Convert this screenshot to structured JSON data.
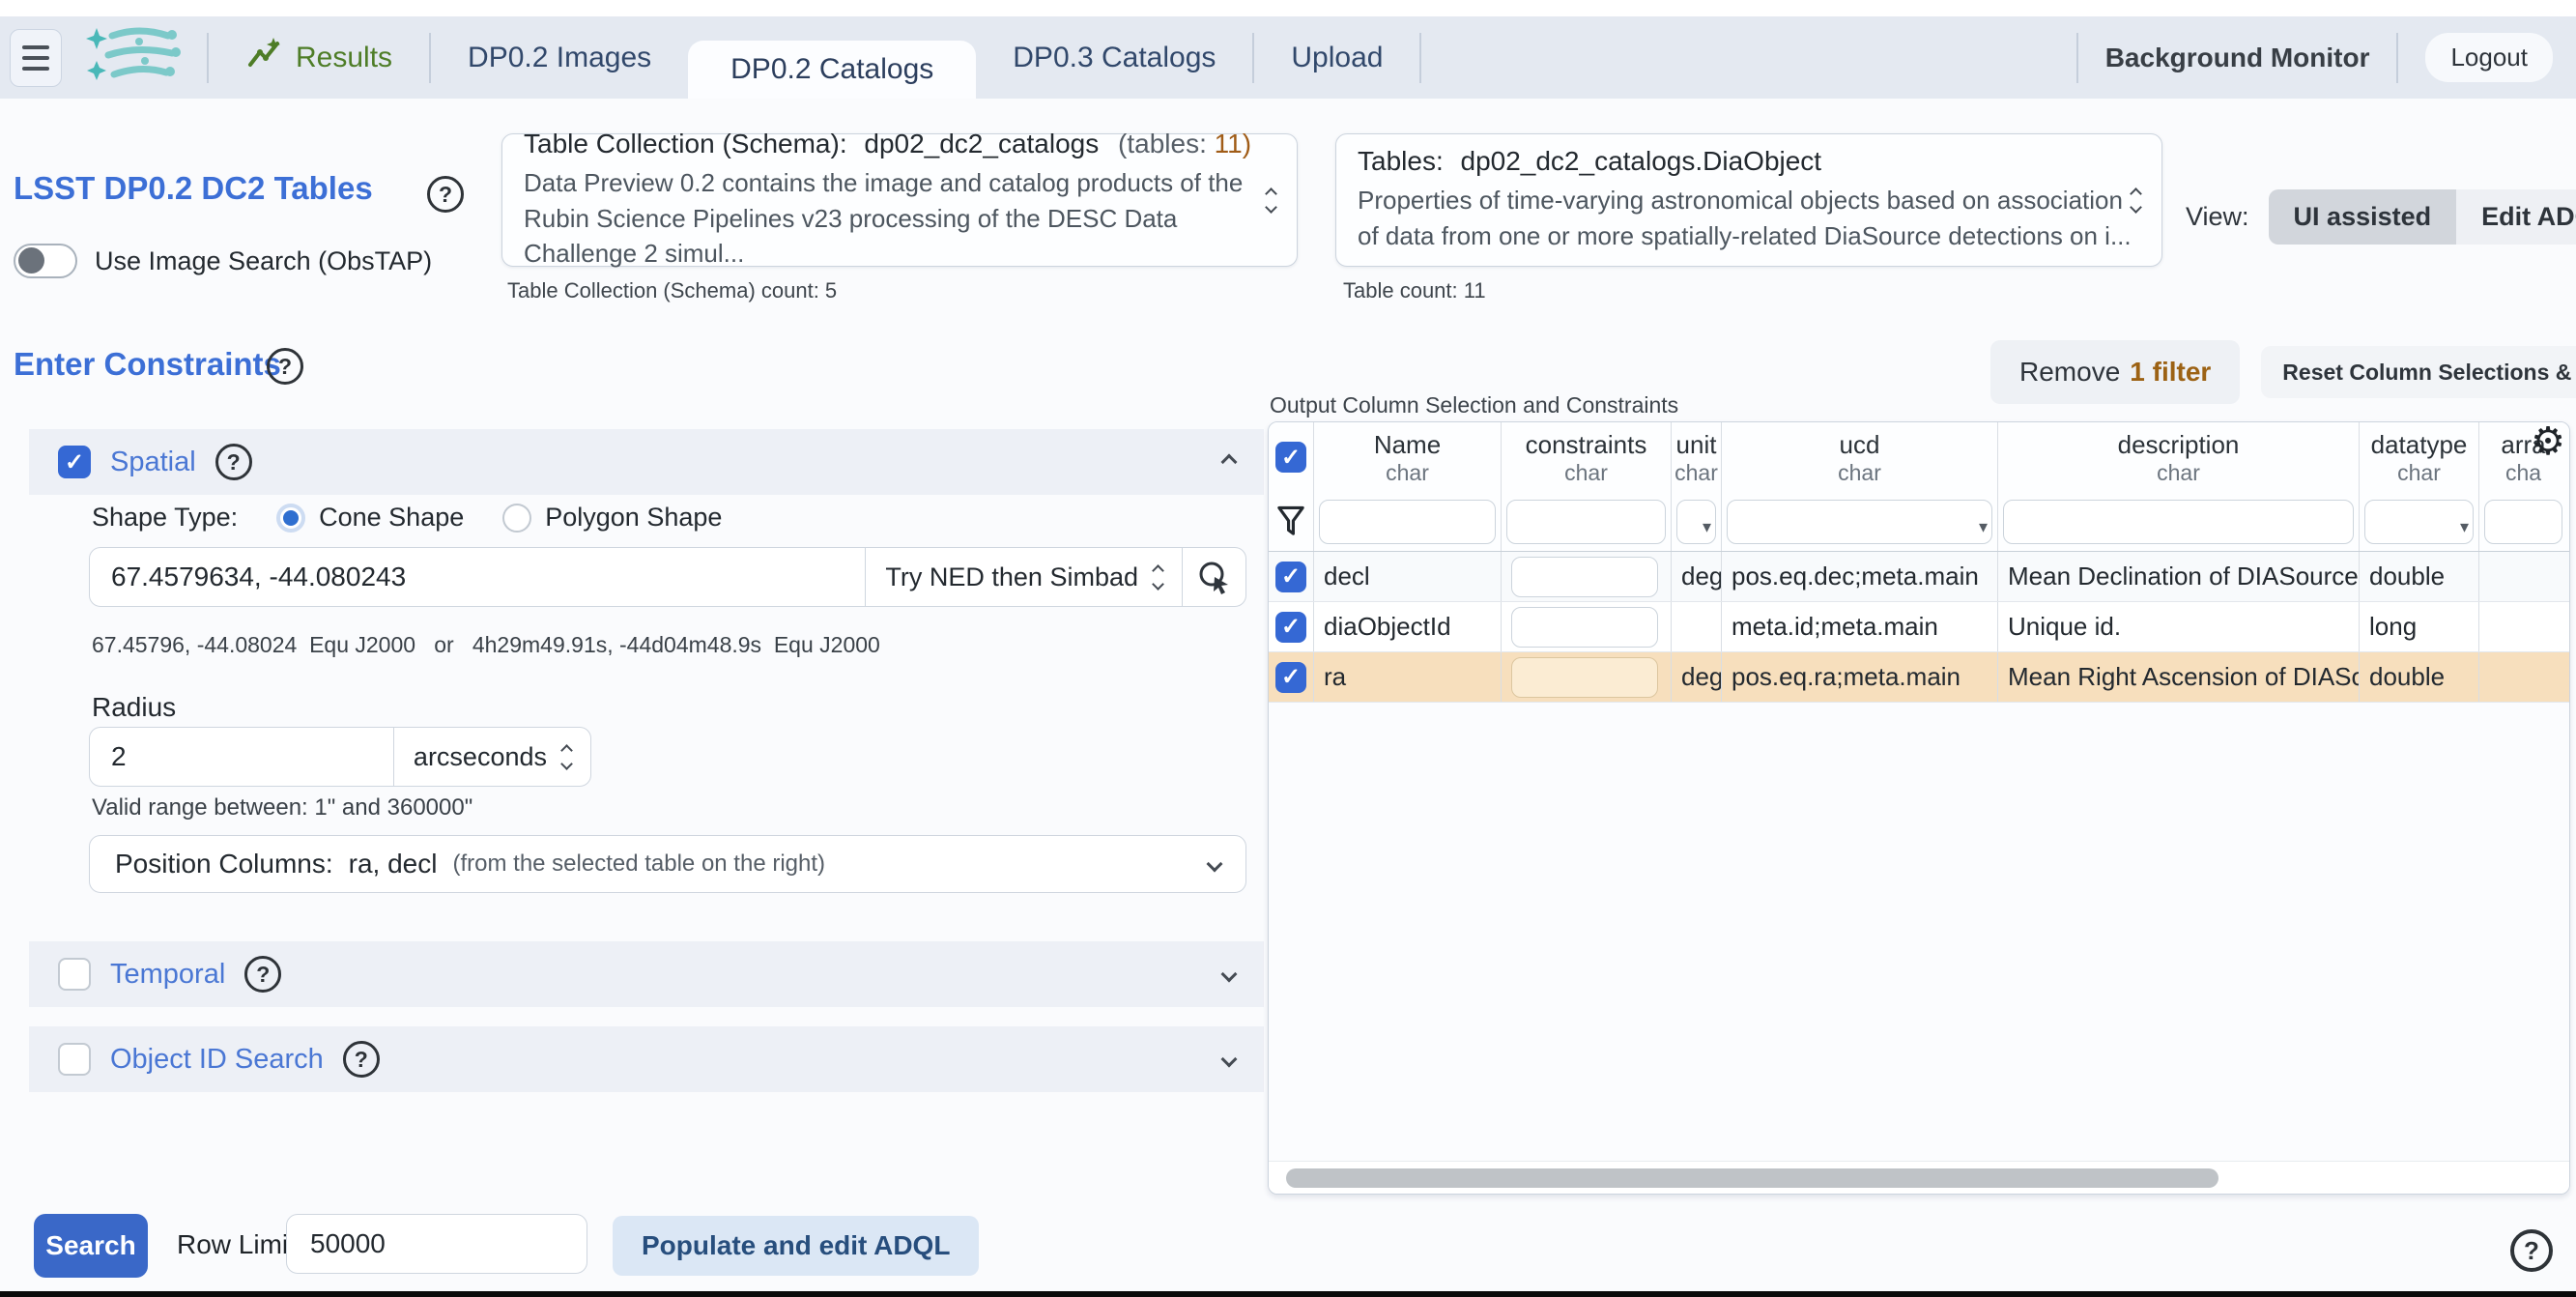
{
  "colors": {
    "topbar_bg": "#e4e9f1",
    "accent_blue": "#3c6fd6",
    "checkbox_blue": "#3568d4",
    "search_btn": "#3a68c8",
    "results_green": "#4e7d27",
    "logo_teal": "#76c8c8",
    "count_orange": "#a05c17",
    "highlight_row": "#f7dfbd"
  },
  "topbar": {
    "tabs": [
      {
        "label": "Results"
      },
      {
        "label": "DP0.2 Images"
      },
      {
        "label": "DP0.2 Catalogs"
      },
      {
        "label": "DP0.3 Catalogs"
      },
      {
        "label": "Upload"
      }
    ],
    "active_tab": "DP0.2 Catalogs",
    "background_monitor": "Background Monitor",
    "logout": "Logout"
  },
  "header": {
    "title": "LSST DP0.2 DC2 Tables",
    "image_search_toggle_label": "Use Image Search (ObsTAP)",
    "schema": {
      "label": "Table Collection (Schema):",
      "value": "dp02_dc2_catalogs",
      "tables_label": "(tables:",
      "tables_count": "11)",
      "description": "Data Preview 0.2 contains the image and catalog products of the Rubin Science Pipelines v23 processing of the DESC Data Challenge 2 simul...",
      "count_note": "Table Collection (Schema) count: 5"
    },
    "table": {
      "label": "Tables:",
      "value": "dp02_dc2_catalogs.DiaObject",
      "description": "Properties of time-varying astronomical objects based on association of data from one or more spatially-related DiaSource detections on i...",
      "count_note": "Table count: 11"
    },
    "view": {
      "label": "View:",
      "options": [
        {
          "label": "UI assisted"
        },
        {
          "label": "Edit ADQL"
        }
      ],
      "selected": "UI assisted"
    }
  },
  "constraints": {
    "title": "Enter Constraints",
    "spatial": {
      "label": "Spatial",
      "checked": true,
      "shape_type_label": "Shape Type:",
      "shapes": [
        {
          "label": "Cone Shape"
        },
        {
          "label": "Polygon Shape"
        }
      ],
      "selected_shape": "Cone Shape",
      "coord_value": "67.4579634, -44.080243",
      "resolver": "Try NED then Simbad",
      "coord_feedback": "67.45796, -44.08024  Equ J2000   or   4h29m49.91s, -44d04m48.9s  Equ J2000",
      "radius_label": "Radius",
      "radius_value": "2",
      "radius_unit": "arcseconds",
      "radius_hint": "Valid range between: 1\" and 360000\"",
      "position_columns_label": "Position Columns:",
      "position_columns_value": "ra, decl",
      "position_columns_note": "(from the selected table on the right)"
    },
    "temporal": {
      "label": "Temporal",
      "checked": false
    },
    "object_id": {
      "label": "Object ID Search",
      "checked": false
    }
  },
  "column_panel": {
    "remove_filter_prefix": "Remove",
    "remove_filter_count": "1 filter",
    "reset_label": "Reset Column Selections & Constraints",
    "panel_title": "Output Column Selection and Constraints",
    "columns": [
      {
        "name": "Name",
        "type": "char"
      },
      {
        "name": "constraints",
        "type": "char"
      },
      {
        "name": "unit",
        "type": "char"
      },
      {
        "name": "ucd",
        "type": "char"
      },
      {
        "name": "description",
        "type": "char"
      },
      {
        "name": "datatype",
        "type": "char"
      },
      {
        "name": "arra",
        "type": "cha"
      }
    ],
    "rows": [
      {
        "name": "decl",
        "unit": "deg",
        "ucd": "pos.eq.dec;meta.main",
        "description": "Mean Declination of DIASources in th",
        "datatype": "double"
      },
      {
        "name": "diaObjectId",
        "unit": "",
        "ucd": "meta.id;meta.main",
        "description": "Unique id.",
        "datatype": "long"
      },
      {
        "name": "ra",
        "unit": "deg",
        "ucd": "pos.eq.ra;meta.main",
        "description": "Mean Right Ascension of DIASources",
        "datatype": "double"
      }
    ]
  },
  "footer": {
    "search_label": "Search",
    "row_limit_label": "Row Limit:",
    "row_limit_value": "50000",
    "populate_label": "Populate and edit ADQL"
  }
}
